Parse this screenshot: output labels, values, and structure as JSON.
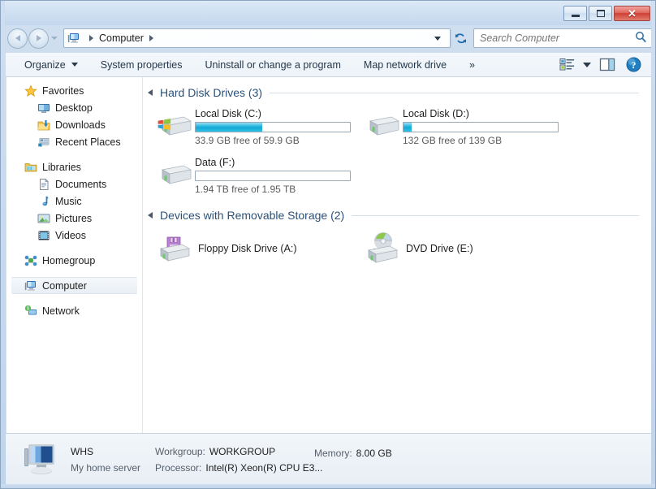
{
  "window": {
    "title": "Computer",
    "controls": {
      "minimize": "Minimize",
      "maximize": "Maximize",
      "close": "Close",
      "close_glyph": "✕"
    }
  },
  "address_bar": {
    "back_tooltip": "Back",
    "forward_tooltip": "Forward",
    "recent_pages_tooltip": "Recent Pages",
    "crumbs": [
      "Computer"
    ],
    "refresh_tooltip": "Refresh",
    "previous_locations_tooltip": "Previous Locations"
  },
  "search": {
    "placeholder": "Search Computer",
    "value": "",
    "icon": "search-icon"
  },
  "toolbar": {
    "items": [
      {
        "label": "Organize",
        "has_caret": true
      },
      {
        "label": "System properties",
        "has_caret": false
      },
      {
        "label": "Uninstall or change a program",
        "has_caret": false
      },
      {
        "label": "Map network drive",
        "has_caret": false
      },
      {
        "label": "»",
        "has_caret": false
      }
    ],
    "right_icons": [
      {
        "name": "change-view-icon",
        "label": "Change your view"
      },
      {
        "name": "view-caret-icon",
        "label": "View options"
      },
      {
        "name": "preview-pane-icon",
        "label": "Show the preview pane"
      },
      {
        "name": "help-icon",
        "label": "Get help"
      }
    ]
  },
  "nav_pane": {
    "groups": [
      {
        "header": {
          "label": "Favorites",
          "icon": "star-icon"
        },
        "items": [
          {
            "label": "Desktop",
            "icon": "desktop-icon"
          },
          {
            "label": "Downloads",
            "icon": "downloads-icon"
          },
          {
            "label": "Recent Places",
            "icon": "recent-places-icon"
          }
        ]
      },
      {
        "header": {
          "label": "Libraries",
          "icon": "libraries-icon"
        },
        "items": [
          {
            "label": "Documents",
            "icon": "documents-icon"
          },
          {
            "label": "Music",
            "icon": "music-icon"
          },
          {
            "label": "Pictures",
            "icon": "pictures-icon"
          },
          {
            "label": "Videos",
            "icon": "videos-icon"
          }
        ]
      },
      {
        "header": {
          "label": "Homegroup",
          "icon": "homegroup-icon"
        },
        "items": []
      },
      {
        "header": {
          "label": "Computer",
          "icon": "computer-icon",
          "selected": true
        },
        "items": []
      },
      {
        "header": {
          "label": "Network",
          "icon": "network-icon"
        },
        "items": []
      }
    ]
  },
  "file_pane": {
    "groups": [
      {
        "label": "Hard Disk Drives (3)",
        "expanded": true,
        "drives": [
          {
            "name": "Local Disk (C:)",
            "icon": "hard-drive-windows-icon",
            "has_gauge": true,
            "used_percent": 43,
            "gauge_color": "#13a8d4",
            "free_text": "33.9 GB free of 59.9 GB"
          },
          {
            "name": "Local Disk (D:)",
            "icon": "hard-drive-icon",
            "has_gauge": true,
            "used_percent": 5,
            "gauge_color": "#13a8d4",
            "free_text": "132 GB free of 139 GB"
          },
          {
            "name": "Data (F:)",
            "icon": "hard-drive-icon",
            "has_gauge": true,
            "used_percent": 0,
            "gauge_color": "#13a8d4",
            "free_text": "1.94 TB free of 1.95 TB"
          }
        ]
      },
      {
        "label": "Devices with Removable Storage (2)",
        "expanded": true,
        "devices": [
          {
            "name": "Floppy Disk Drive (A:)",
            "icon": "floppy-drive-icon"
          },
          {
            "name": "DVD Drive (E:)",
            "icon": "dvd-drive-icon"
          }
        ]
      }
    ]
  },
  "status_bar": {
    "icon": "computer-large-icon",
    "computer_name": "WHS",
    "description": "My home server",
    "workgroup_label": "Workgroup:",
    "workgroup_value": "WORKGROUP",
    "processor_label": "Processor:",
    "processor_value": "Intel(R) Xeon(R) CPU E3...",
    "memory_label": "Memory:",
    "memory_value": "8.00 GB"
  },
  "colors": {
    "accent": "#2b5178",
    "gauge_fill": "#13a8d4",
    "frame": "#c3d8ee",
    "close_button": "#cf3f34"
  }
}
